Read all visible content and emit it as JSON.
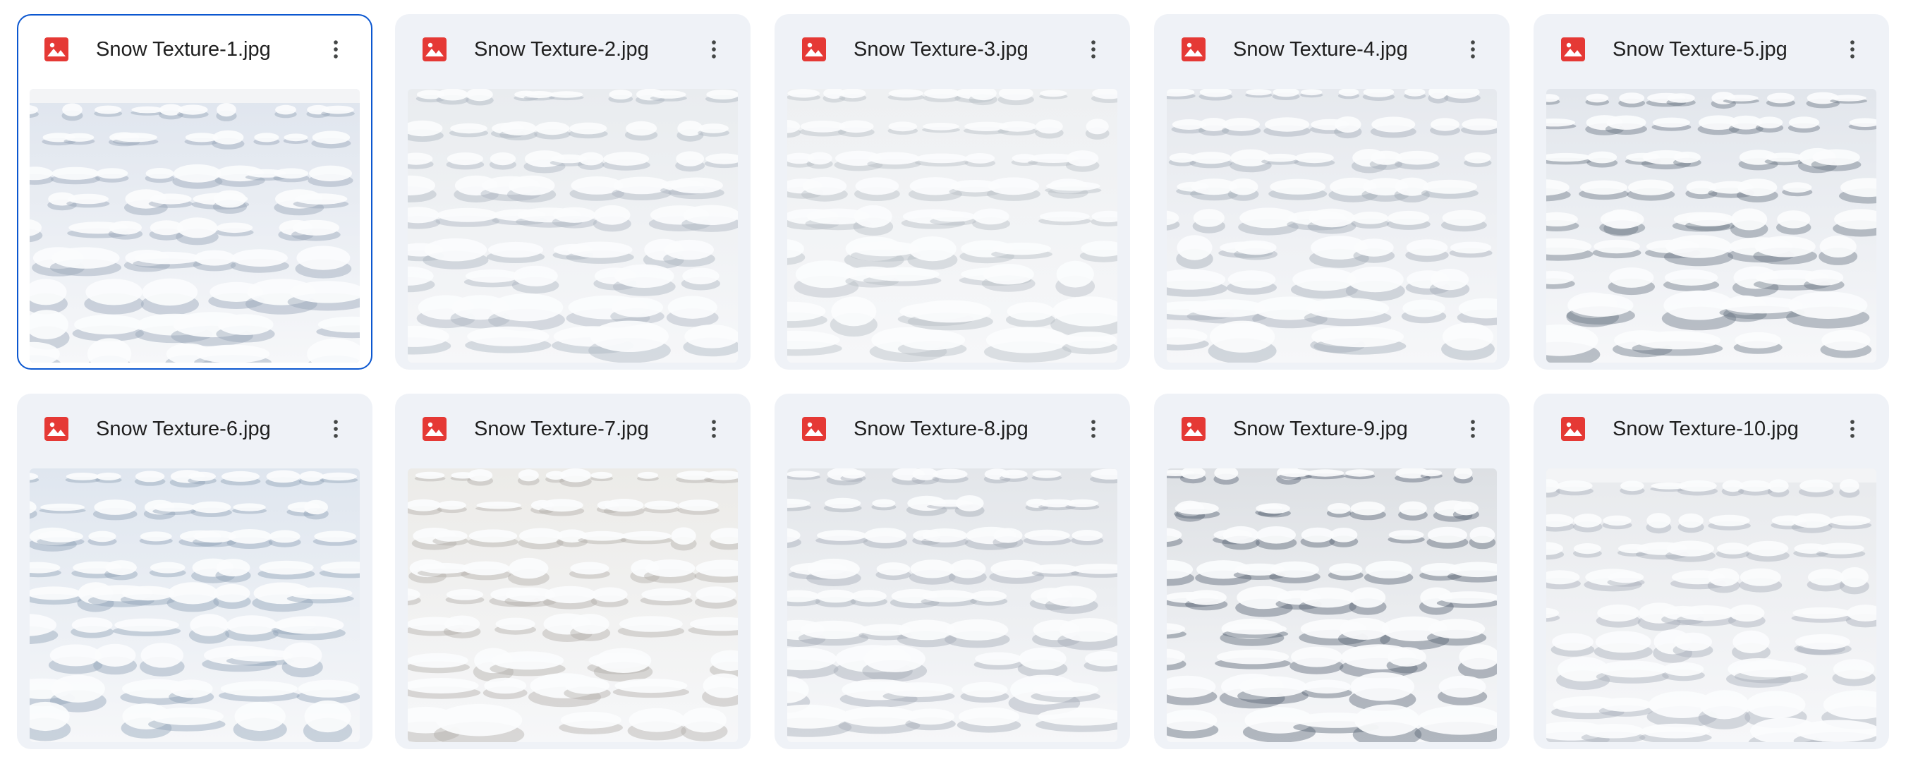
{
  "files": [
    {
      "name": "Snow Texture-1.jpg",
      "selected": true,
      "sky": true,
      "tone": "#dfe5ee",
      "shadow": "#9aa6b8"
    },
    {
      "name": "Snow Texture-2.jpg",
      "selected": false,
      "sky": false,
      "tone": "#e9ecef",
      "shadow": "#aeb6c0"
    },
    {
      "name": "Snow Texture-3.jpg",
      "selected": false,
      "sky": false,
      "tone": "#eef0f2",
      "shadow": "#b9bec6"
    },
    {
      "name": "Snow Texture-4.jpg",
      "selected": false,
      "sky": false,
      "tone": "#e6e9ee",
      "shadow": "#a3acb8"
    },
    {
      "name": "Snow Texture-5.jpg",
      "selected": false,
      "sky": false,
      "tone": "#e2e6ec",
      "shadow": "#6f7a88"
    },
    {
      "name": "Snow Texture-6.jpg",
      "selected": false,
      "sky": false,
      "tone": "#dfe6ef",
      "shadow": "#93a3b8"
    },
    {
      "name": "Snow Texture-7.jpg",
      "selected": false,
      "sky": false,
      "tone": "#ecebe8",
      "shadow": "#b3b0aa"
    },
    {
      "name": "Snow Texture-8.jpg",
      "selected": false,
      "sky": false,
      "tone": "#e3e6ea",
      "shadow": "#a6adb7"
    },
    {
      "name": "Snow Texture-9.jpg",
      "selected": false,
      "sky": false,
      "tone": "#dde0e4",
      "shadow": "#5e6878"
    },
    {
      "name": "Snow Texture-10.jpg",
      "selected": false,
      "sky": true,
      "tone": "#e8eaed",
      "shadow": "#a9b0ba"
    }
  ],
  "icons": {
    "file_type": "image-file-icon",
    "menu": "more-vertical-icon"
  },
  "colors": {
    "card_bg": "#eff2f7",
    "selected_border": "#0b57d0",
    "image_icon": "#e53935",
    "text": "#1f1f1f"
  }
}
